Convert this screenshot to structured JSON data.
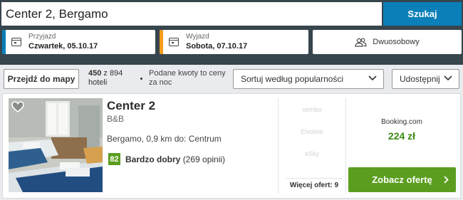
{
  "search": {
    "value": "Center 2, Bergamo",
    "button_label": "Szukaj"
  },
  "checkin": {
    "label": "Przyjazd",
    "value": "Czwartek, 05.10.17",
    "accent": "#0a7fb8"
  },
  "checkout": {
    "label": "Wyjazd",
    "value": "Sobota, 07.10.17",
    "accent": "#f29b1d"
  },
  "room": {
    "label": "Dwuosobowy",
    "icon": "two-people-icon"
  },
  "toolbar": {
    "map_button": "Przejdź do mapy",
    "hotel_count": "450",
    "hotel_count_rest": " z 894",
    "hotel_count_unit": "hotel​i",
    "prices_note": "Podane kwoty to ceny za noc",
    "sort_value": "Sortuj według popularności",
    "share_label": "Udostępnij"
  },
  "result": {
    "name": "Center 2",
    "type": "B&B",
    "location": "Bergamo, 0,9 km do: Centrum",
    "rating_score": "82",
    "rating_label": "Bardzo dobry",
    "rating_count": "(269 opinii)",
    "alternatives": [
      {
        "provider": "sembo",
        "price": "-"
      },
      {
        "provider": "Elvoline",
        "price": "-"
      },
      {
        "provider": "eSky",
        "price": "-"
      }
    ],
    "more_offers": "Więcej ofert: 9",
    "best_provider": "Booking.com",
    "best_price": "224 zł",
    "cta_label": "Zobacz ofertę"
  },
  "colors": {
    "topbar": "#37454d",
    "search_button": "#0a7fb8",
    "rating_green": "#5b9e1f",
    "price_green": "#3c8a14"
  }
}
